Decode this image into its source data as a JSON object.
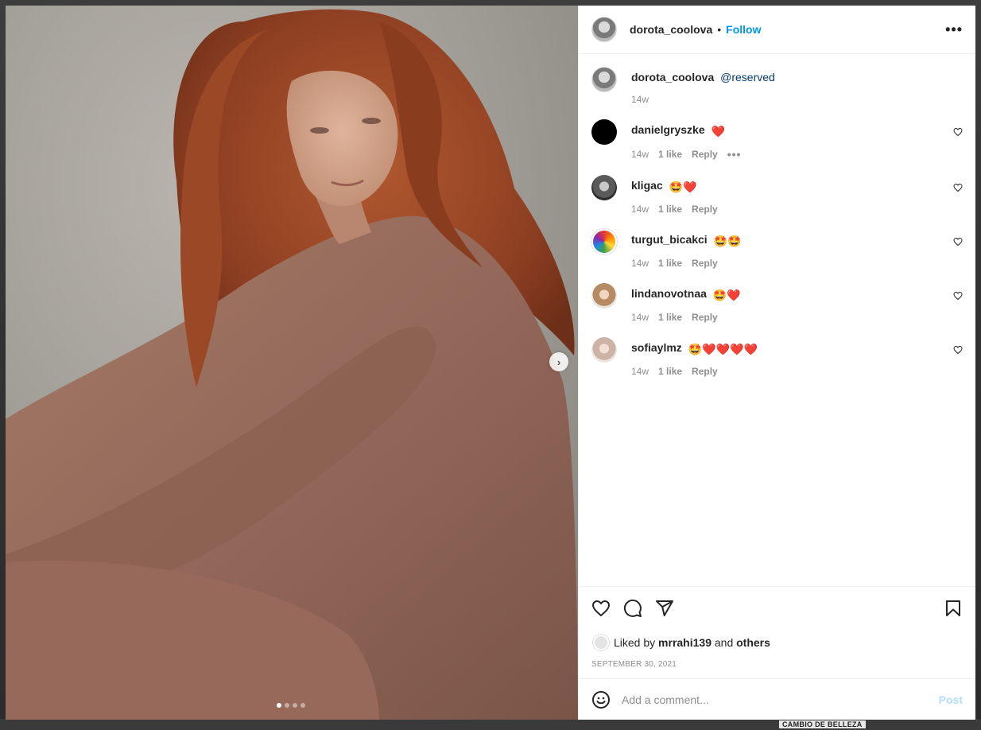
{
  "backdrop": {
    "caption": "CAMBIO DE BELLEZA"
  },
  "post": {
    "owner": "dorota_coolova",
    "separator": "•",
    "follow_label": "Follow",
    "more_label": "•••",
    "carousel": {
      "count": 4,
      "active": 0,
      "next_glyph": "›"
    }
  },
  "caption": {
    "user": "dorota_coolova",
    "mention": "@reserved",
    "time": "14w"
  },
  "comments": [
    {
      "user": "danielgryszke",
      "emojis": [
        "❤️"
      ],
      "time": "14w",
      "likes": "1 like",
      "reply": "Reply",
      "more": "•••",
      "avatar": "black"
    },
    {
      "user": "kligac",
      "emojis": [
        "🤩",
        "❤️"
      ],
      "time": "14w",
      "likes": "1 like",
      "reply": "Reply",
      "avatar": "kligac"
    },
    {
      "user": "turgut_bicakci",
      "emojis": [
        "🤩",
        "🤩"
      ],
      "time": "14w",
      "likes": "1 like",
      "reply": "Reply",
      "avatar": "turgut"
    },
    {
      "user": "lindanovotnaa",
      "emojis": [
        "🤩",
        "❤️"
      ],
      "time": "14w",
      "likes": "1 like",
      "reply": "Reply",
      "avatar": "linda"
    },
    {
      "user": "sofiaylmz",
      "emojis": [
        "🤩",
        "❤️",
        "❤️",
        "❤️",
        "❤️"
      ],
      "time": "14w",
      "likes": "1 like",
      "reply": "Reply",
      "avatar": "sofia"
    }
  ],
  "likes": {
    "prefix": "Liked by",
    "user": "mrrahi139",
    "conj": "and",
    "others": "others"
  },
  "date": "SEPTEMBER 30, 2021",
  "composer": {
    "placeholder": "Add a comment...",
    "post_label": "Post"
  },
  "icons": {
    "like": "heart-icon",
    "comment": "comment-icon",
    "share": "paper-plane-icon",
    "save": "bookmark-icon",
    "emoji": "smiley-icon"
  },
  "colors": {
    "link": "#0095f6",
    "mention": "#00376b",
    "heart": "#ed4956",
    "muted": "#8e8e8e"
  }
}
